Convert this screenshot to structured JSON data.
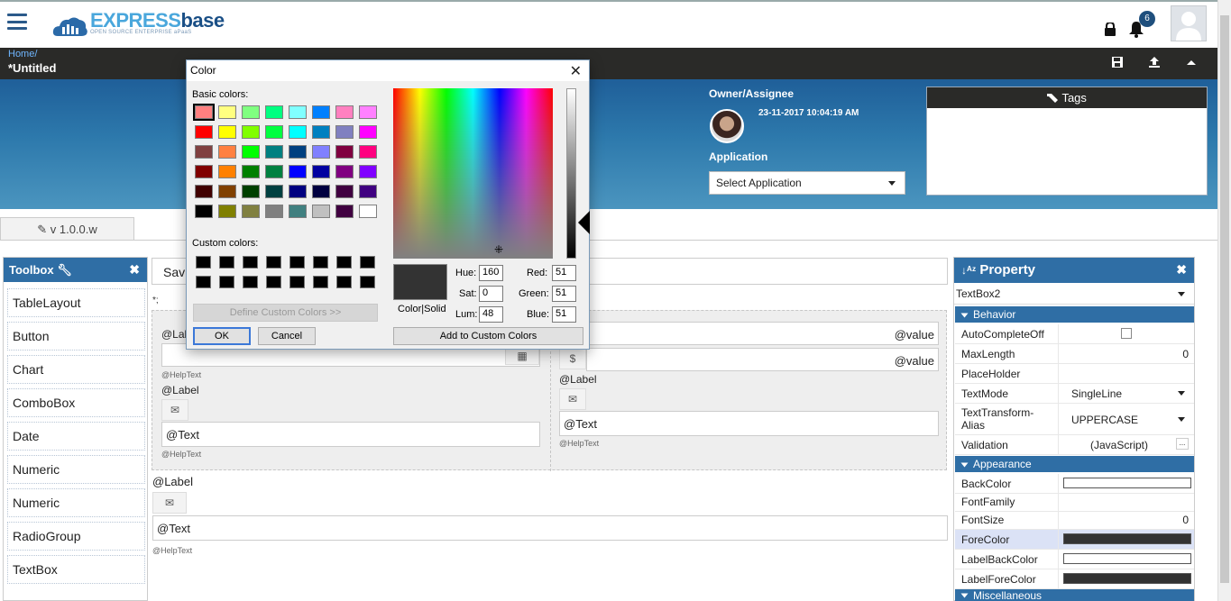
{
  "brand": {
    "logo_main": "EXPRESS",
    "logo_bold": "base",
    "tagline": "OPEN SOURCE ENTERPRISE aPaaS"
  },
  "header": {
    "notifications": "6",
    "breadcrumb_home": "Home/",
    "title": "*Untitled"
  },
  "meta": {
    "owner_label": "Owner/Assignee",
    "timestamp": "23-11-2017 10:04:19 AM",
    "application_label": "Application",
    "application_select": "Select Application",
    "tags_label": "Tags"
  },
  "tab": {
    "version": "v 1.0.0.w"
  },
  "toolbox": {
    "title": "Toolbox",
    "items": [
      "TableLayout",
      "Button",
      "Chart",
      "ComboBox",
      "Date",
      "Numeric",
      "Numeric",
      "RadioGroup",
      "TextBox"
    ]
  },
  "canvas": {
    "save": "Sav",
    "semicolon": "*;",
    "label": "@Label",
    "text": "@Text",
    "help": "@HelpText",
    "value": "@value",
    "dollar": "$"
  },
  "property": {
    "title": "Property",
    "selected": "TextBox2",
    "behavior": "Behavior",
    "appearance": "Appearance",
    "misc": "Miscellaneous",
    "rows": {
      "autocomplete": "AutoCompleteOff",
      "maxlength": "MaxLength",
      "maxlength_v": "0",
      "placeholder": "PlaceHolder",
      "textmode": "TextMode",
      "textmode_v": "SingleLine",
      "texttransform": "TextTransform-Alias",
      "texttransform_v": "UPPERCASE",
      "validation": "Validation",
      "validation_v": "(JavaScript)",
      "backcolor": "BackColor",
      "fontfamily": "FontFamily",
      "fontsize": "FontSize",
      "fontsize_v": "0",
      "forecolor": "ForeColor",
      "labelbackcolor": "LabelBackColor",
      "labelforecolor": "LabelForeColor"
    },
    "colors": {
      "backcolor": "#ffffff",
      "forecolor": "#333333",
      "labelbackcolor": "#ffffff",
      "labelforecolor": "#333333"
    }
  },
  "dialog": {
    "title": "Color",
    "basic_colors": "Basic colors:",
    "custom_colors": "Custom colors:",
    "define_btn": "Define Custom Colors >>",
    "ok": "OK",
    "cancel": "Cancel",
    "add_btn": "Add to Custom Colors",
    "color_solid": "Color|Solid",
    "hue_label": "Hue:",
    "hue": "160",
    "sat_label": "Sat:",
    "sat": "0",
    "lum_label": "Lum:",
    "lum": "48",
    "red_label": "Red:",
    "red": "51",
    "green_label": "Green:",
    "green": "51",
    "blue_label": "Blue:",
    "blue": "51",
    "basic_palette": [
      "#ff8080",
      "#ffff80",
      "#80ff80",
      "#00ff80",
      "#80ffff",
      "#0080ff",
      "#ff80c0",
      "#ff80ff",
      "#ff0000",
      "#ffff00",
      "#80ff00",
      "#00ff40",
      "#00ffff",
      "#0080c0",
      "#8080c0",
      "#ff00ff",
      "#804040",
      "#ff8040",
      "#00ff00",
      "#008080",
      "#004080",
      "#8080ff",
      "#800040",
      "#ff0080",
      "#800000",
      "#ff8000",
      "#008000",
      "#008040",
      "#0000ff",
      "#0000a0",
      "#800080",
      "#8000ff",
      "#400000",
      "#804000",
      "#004000",
      "#004040",
      "#000080",
      "#000040",
      "#400040",
      "#400080",
      "#000000",
      "#808000",
      "#808040",
      "#808080",
      "#408080",
      "#c0c0c0",
      "#400040",
      "#ffffff"
    ]
  }
}
